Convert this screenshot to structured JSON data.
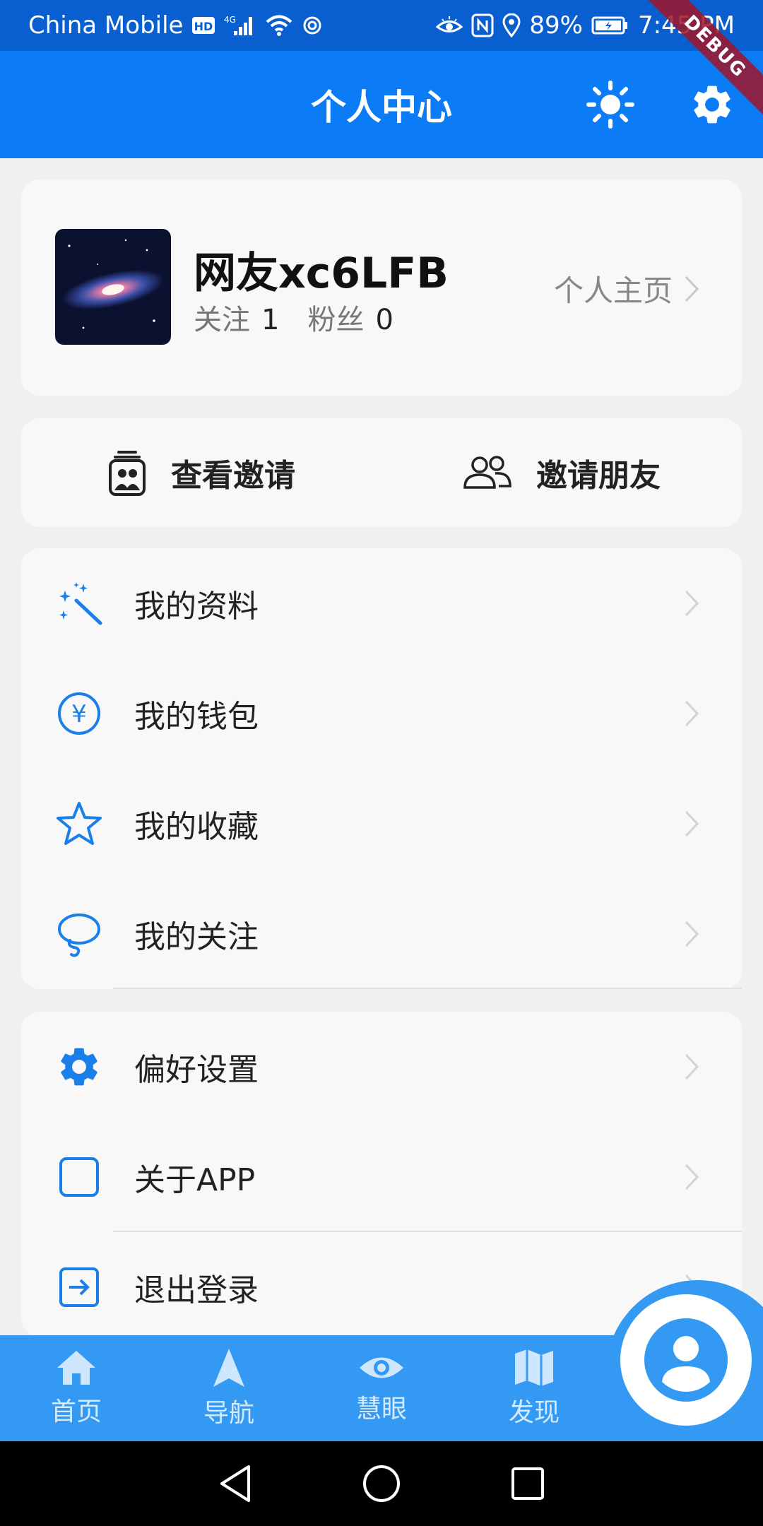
{
  "status_bar": {
    "carrier": "China Mobile",
    "network": "4G",
    "battery": "89%",
    "time": "7:45 PM"
  },
  "debug_banner": "DEBUG",
  "app_bar": {
    "title": "个人中心",
    "theme_icon": "sun-icon",
    "settings_icon": "gear-icon"
  },
  "profile": {
    "username": "网友xc6LFB",
    "following_label": "关注",
    "following_count": "1",
    "followers_label": "粉丝",
    "followers_count": "0",
    "homepage_label": "个人主页"
  },
  "invite": {
    "view_label": "查看邀请",
    "invite_label": "邀请朋友"
  },
  "menu": {
    "items": [
      {
        "label": "我的资料",
        "icon": "magic-wand-icon"
      },
      {
        "label": "我的钱包",
        "icon": "yen-icon"
      },
      {
        "label": "我的收藏",
        "icon": "star-icon"
      },
      {
        "label": "我的关注",
        "icon": "lasso-icon"
      }
    ]
  },
  "settings": {
    "items": [
      {
        "label": "偏好设置",
        "icon": "gear-icon"
      },
      {
        "label": "关于APP",
        "icon": "square-icon"
      },
      {
        "label": "退出登录",
        "icon": "logout-icon"
      }
    ]
  },
  "bottom_nav": {
    "items": [
      {
        "label": "首页",
        "icon": "home-icon"
      },
      {
        "label": "导航",
        "icon": "navigation-icon"
      },
      {
        "label": "慧眼",
        "icon": "eye-icon"
      },
      {
        "label": "发现",
        "icon": "map-icon"
      }
    ],
    "fab_icon": "account-icon"
  },
  "colors": {
    "primary": "#0b7cf5",
    "status_bar": "#0a5fd0",
    "nav": "#3399f3",
    "icon_blue": "#1a7fe8"
  }
}
